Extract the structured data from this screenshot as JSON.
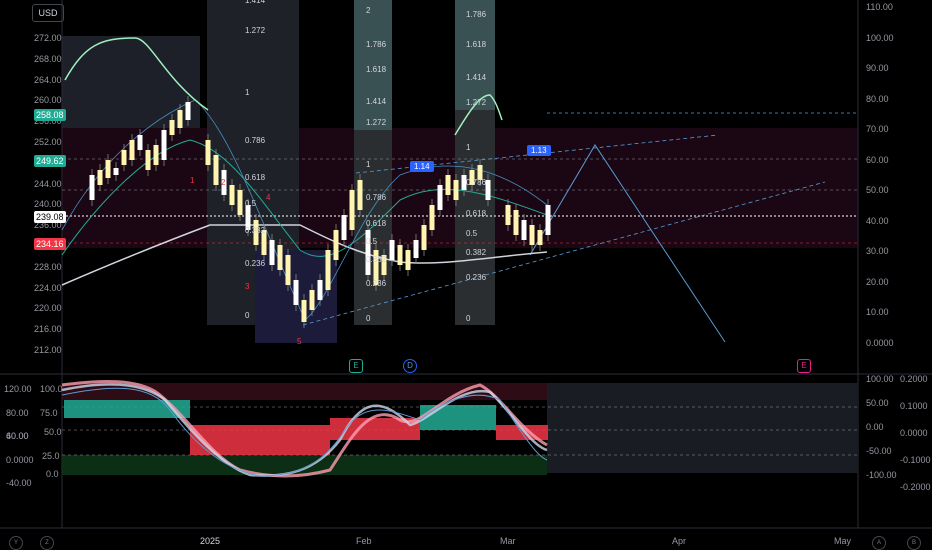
{
  "currency_button": "USD",
  "left_axis": [
    "272.00",
    "268.00",
    "264.00",
    "260.00",
    "256.00",
    "252.00",
    "248.00",
    "244.00",
    "240.00",
    "236.00",
    "232.00",
    "228.00",
    "224.00",
    "220.00",
    "216.00",
    "212.00"
  ],
  "right_axis": [
    "110.00",
    "100.00",
    "90.00",
    "80.00",
    "70.00",
    "60.00",
    "50.00",
    "40.00",
    "30.00",
    "20.00",
    "10.00",
    "0.0000"
  ],
  "price_badges": {
    "high": "258.08",
    "mid": "249.62",
    "current": "239.08",
    "low": "234.16"
  },
  "fib_col1": [
    "1.414",
    "1.272",
    "1",
    "0.786",
    "0.618",
    "0.5",
    "0.382",
    "0.236",
    "0"
  ],
  "fib_col2": [
    "2",
    "1.786",
    "1.618",
    "1.414",
    "1.272",
    "1",
    "0.786",
    "0.618",
    "0.5",
    "0.382",
    "0.236",
    "0"
  ],
  "fib_col3": [
    "1.786",
    "1.618",
    "1.414",
    "1.272",
    "1",
    "0.786",
    "0.618",
    "0.5",
    "0.382",
    "0.236",
    "0"
  ],
  "fib_tags": [
    "1.14",
    "1.13"
  ],
  "wave_labels": [
    "1",
    "2",
    "3",
    "4",
    "5"
  ],
  "event_markers": [
    "E",
    "D",
    "E"
  ],
  "osc_left_axis": [
    "120.00",
    "100.0",
    "80.00",
    "75.0",
    "60.00",
    "50.0",
    "40.00",
    "25.0",
    "0.0000",
    "0.0",
    "-40.00"
  ],
  "osc_right_axis_a": [
    "100.00",
    "50.00",
    "0.00",
    "-50.00",
    "-100.00"
  ],
  "osc_right_axis_b": [
    "0.2000",
    "0.1000",
    "0.0000",
    "-0.1000",
    "-0.2000"
  ],
  "time_axis": [
    "2025",
    "Feb",
    "Mar",
    "Apr",
    "May"
  ],
  "corner_buttons": [
    "Y",
    "Z",
    "A",
    "B"
  ],
  "colors": {
    "bull": "#fff5b0",
    "bear": "#ffffff",
    "green_band": "#22ab94",
    "red_band": "#f23645",
    "fib_blue": "#2962ff",
    "accent": "#5b9bd5"
  }
}
